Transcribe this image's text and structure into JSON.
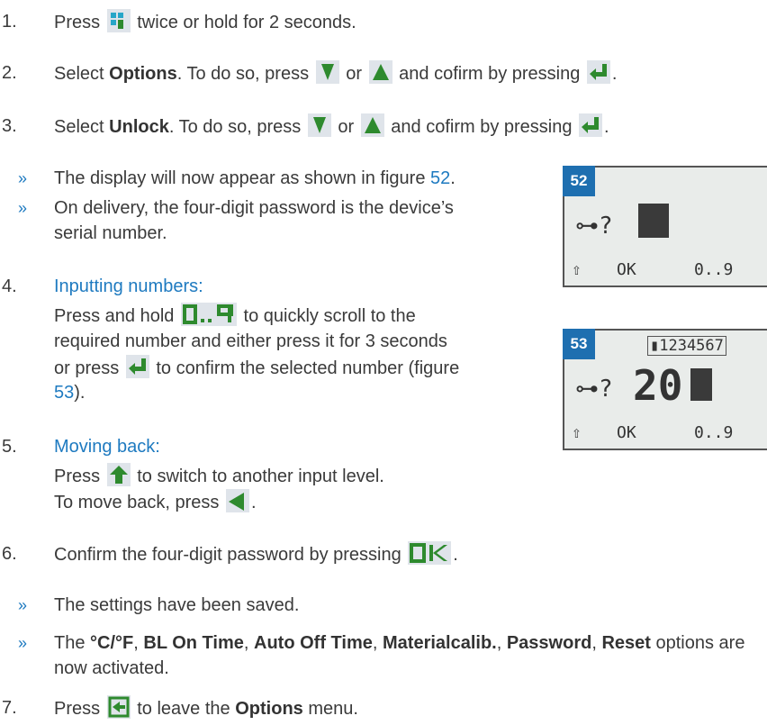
{
  "steps": [
    {
      "num": "1.",
      "a": "Press",
      "b": "twice or hold for 2 seconds."
    },
    {
      "num": "2.",
      "a": "Select",
      "bold": "Options",
      "c": ". To do so, press",
      "or": "or",
      "d": "and cofirm by pressing",
      "end": "."
    },
    {
      "num": "3.",
      "a": "Select",
      "bold": "Unlock",
      "c": ". To do so, press",
      "or": "or",
      "d": "and cofirm by pressing",
      "end": "."
    },
    {
      "num": "4.",
      "title": "Inputting numbers:",
      "l1a": "Press and hold",
      "l1b": "to quickly scroll to the",
      "l2": "required number and either press it for 3 seconds",
      "l3a": "or press",
      "l3b": "to confirm the selected number (figure",
      "l4": "53",
      "l4b": ")."
    },
    {
      "num": "5.",
      "title": "Moving back:",
      "l1a": "Press",
      "l1b": "to switch to another input level.",
      "l2a": "To move back, press",
      "l2b": "."
    },
    {
      "num": "6.",
      "a": "Confirm the four-digit password by pressing",
      "end": "."
    },
    {
      "num": "7.",
      "a": "Press",
      "b": "to leave the",
      "bold": "Options",
      "c": "menu."
    }
  ],
  "notes": {
    "n1a": "The display will now appear as shown in figure",
    "n1ref": "52",
    "n1end": ".",
    "n2": "On delivery, the four-digit password is the device’s",
    "n2b": "serial number.",
    "n3": "The settings have been saved.",
    "n4pre": "The",
    "o1": "°C/°F",
    "o2": "BL On Time",
    "o3": "Auto Off Time",
    "o4": "Materialcalib.",
    "o5": "Password",
    "o6": "Reset",
    "n4post": "options are",
    "n4b": "now activated.",
    "comma": ","
  },
  "bullet": "»",
  "fig52": {
    "tag": "52",
    "key": "⊶?",
    "ok": "OK",
    "range": "0..9",
    "shift": "⇧"
  },
  "fig53": {
    "tag": "53",
    "serial": "▮1234567",
    "key": "⊶?",
    "value": "20",
    "ok": "OK",
    "range": "0..9",
    "shift": "⇧"
  }
}
